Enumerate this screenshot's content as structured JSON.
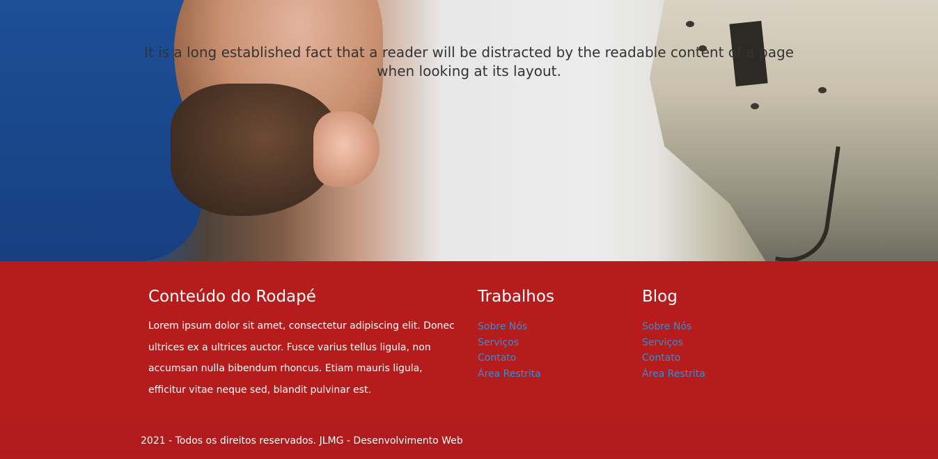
{
  "hero": {
    "text": "It is a long established fact that a reader will be distracted by the readable content of a page when looking at its layout."
  },
  "footer": {
    "about": {
      "title": "Conteúdo do Rodapé",
      "text": "Lorem ipsum dolor sit amet, consectetur adipiscing elit. Donec ultrices ex a ultrices auctor. Fusce varius tellus ligula, non accumsan nulla bibendum rhoncus. Etiam mauris ligula, efficitur vitae neque sed, blandit pulvinar est."
    },
    "work": {
      "title": "Trabalhos",
      "links": [
        "Sobre Nós",
        "Serviços",
        "Contato",
        "Área Restrita"
      ]
    },
    "blog": {
      "title": "Blog",
      "links": [
        "Sobre Nós",
        "Serviços",
        "Contato",
        "Área Restrita"
      ]
    },
    "copyright": "2021 - Todos os direitos reservados. JLMG - Desenvolvimento Web"
  },
  "colors": {
    "footer_bg": "#b71c1c",
    "link": "#2f8fd8"
  }
}
